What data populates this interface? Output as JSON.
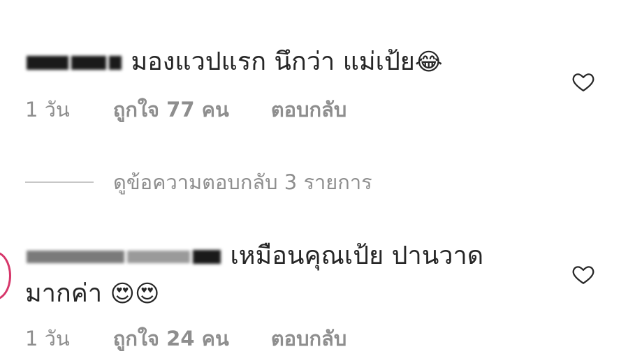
{
  "comments": [
    {
      "username": "■ ■■■■ ■■■",
      "text": "มองแวปแรก นึกว่า แม่เป้ย",
      "emoji": "😂",
      "time": "1 วัน",
      "likes": "ถูกใจ 77 คน",
      "reply_label": "ตอบกลับ",
      "view_replies": "ดูข้อความตอบกลับ 3 รายการ"
    },
    {
      "username": "■■■■■■_■■■■■■■",
      "text_line1": "เหมือนคุณเป้ย ปานวาด",
      "text_line2": "มากค่า",
      "emoji": "😍😍",
      "time": "1 วัน",
      "likes": "ถูกใจ 24 คน",
      "reply_label": "ตอบกลับ"
    }
  ],
  "icons": {
    "like": "heart-outline-icon",
    "avatar": "story-ring"
  },
  "colors": {
    "text": "#262626",
    "meta": "#8e8e8e",
    "divider": "#c7c7c7",
    "story_ring": "#d6366a"
  }
}
